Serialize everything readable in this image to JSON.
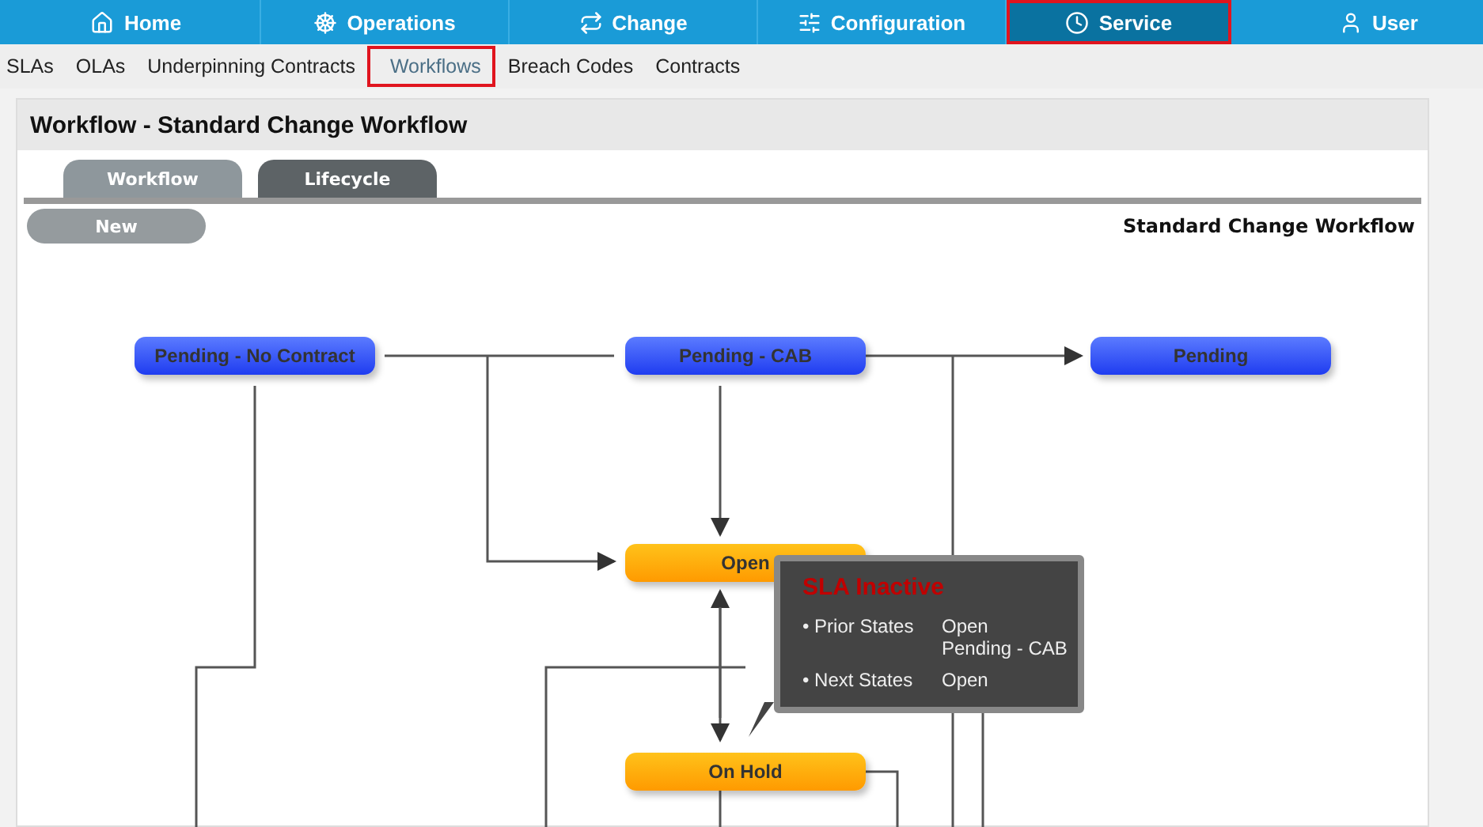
{
  "nav": [
    {
      "label": "Home",
      "selected": false
    },
    {
      "label": "Operations",
      "selected": false
    },
    {
      "label": "Change",
      "selected": false
    },
    {
      "label": "Configuration",
      "selected": false
    },
    {
      "label": "Service",
      "selected": true
    },
    {
      "label": "User",
      "selected": false
    }
  ],
  "subnav": [
    {
      "label": "SLAs",
      "selected": false
    },
    {
      "label": "OLAs",
      "selected": false
    },
    {
      "label": "Underpinning Contracts",
      "selected": false
    },
    {
      "label": "Workflows",
      "selected": true
    },
    {
      "label": "Breach Codes",
      "selected": false
    },
    {
      "label": "Contracts",
      "selected": false
    }
  ],
  "panel": {
    "title": "Workflow - Standard Change Workflow",
    "tabs": [
      {
        "label": "Workflow",
        "selected": false
      },
      {
        "label": "Lifecycle",
        "selected": true
      }
    ],
    "new_button": "New",
    "workflow_name": "Standard Change Workflow"
  },
  "nodes": [
    {
      "label": "Pending - No Contract",
      "kind": "blue"
    },
    {
      "label": "Pending - CAB",
      "kind": "blue"
    },
    {
      "label": "Pending",
      "kind": "blue"
    },
    {
      "label": "Open",
      "kind": "orange"
    },
    {
      "label": "On Hold",
      "kind": "orange"
    }
  ],
  "tooltip": {
    "title": "SLA Inactive",
    "rows": [
      {
        "label": "• Prior States",
        "values": [
          "Open",
          "Pending - CAB"
        ]
      },
      {
        "label": "• Next States",
        "values": [
          "Open"
        ]
      }
    ]
  }
}
